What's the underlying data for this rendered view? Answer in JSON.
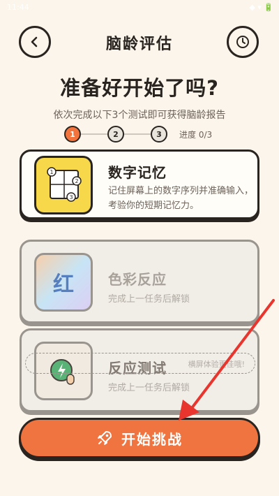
{
  "status": {
    "time": "11:44",
    "right": "◆ ▾ 🔋"
  },
  "header": {
    "title": "脑龄评估",
    "back_icon": "chevron-left-icon",
    "history_icon": "clock-icon"
  },
  "main": {
    "headline": "准备好开始了吗?",
    "subtitle": "依次完成以下3个测试即可获得脑龄报告",
    "steps": [
      "1",
      "2",
      "3"
    ],
    "progress": "进度 0/3"
  },
  "tests": [
    {
      "name": "数字记忆",
      "desc": "记住屏幕上的数字序列并准确输入，考验你的短期记忆力。",
      "state": "unlocked"
    },
    {
      "name": "色彩反应",
      "desc": "完成上一任务后解锁",
      "icon_char": "红",
      "state": "locked"
    },
    {
      "name": "反应测试",
      "desc": "完成上一任务后解锁",
      "state": "locked"
    }
  ],
  "hint": "横屏体验更佳哦!",
  "start_button": {
    "label": "开始挑战",
    "icon": "rocket-icon"
  },
  "colors": {
    "accent": "#f07440",
    "background": "#fbf5ec",
    "memory_icon_bg": "#f7d84a",
    "arrow": "#e8352e"
  }
}
